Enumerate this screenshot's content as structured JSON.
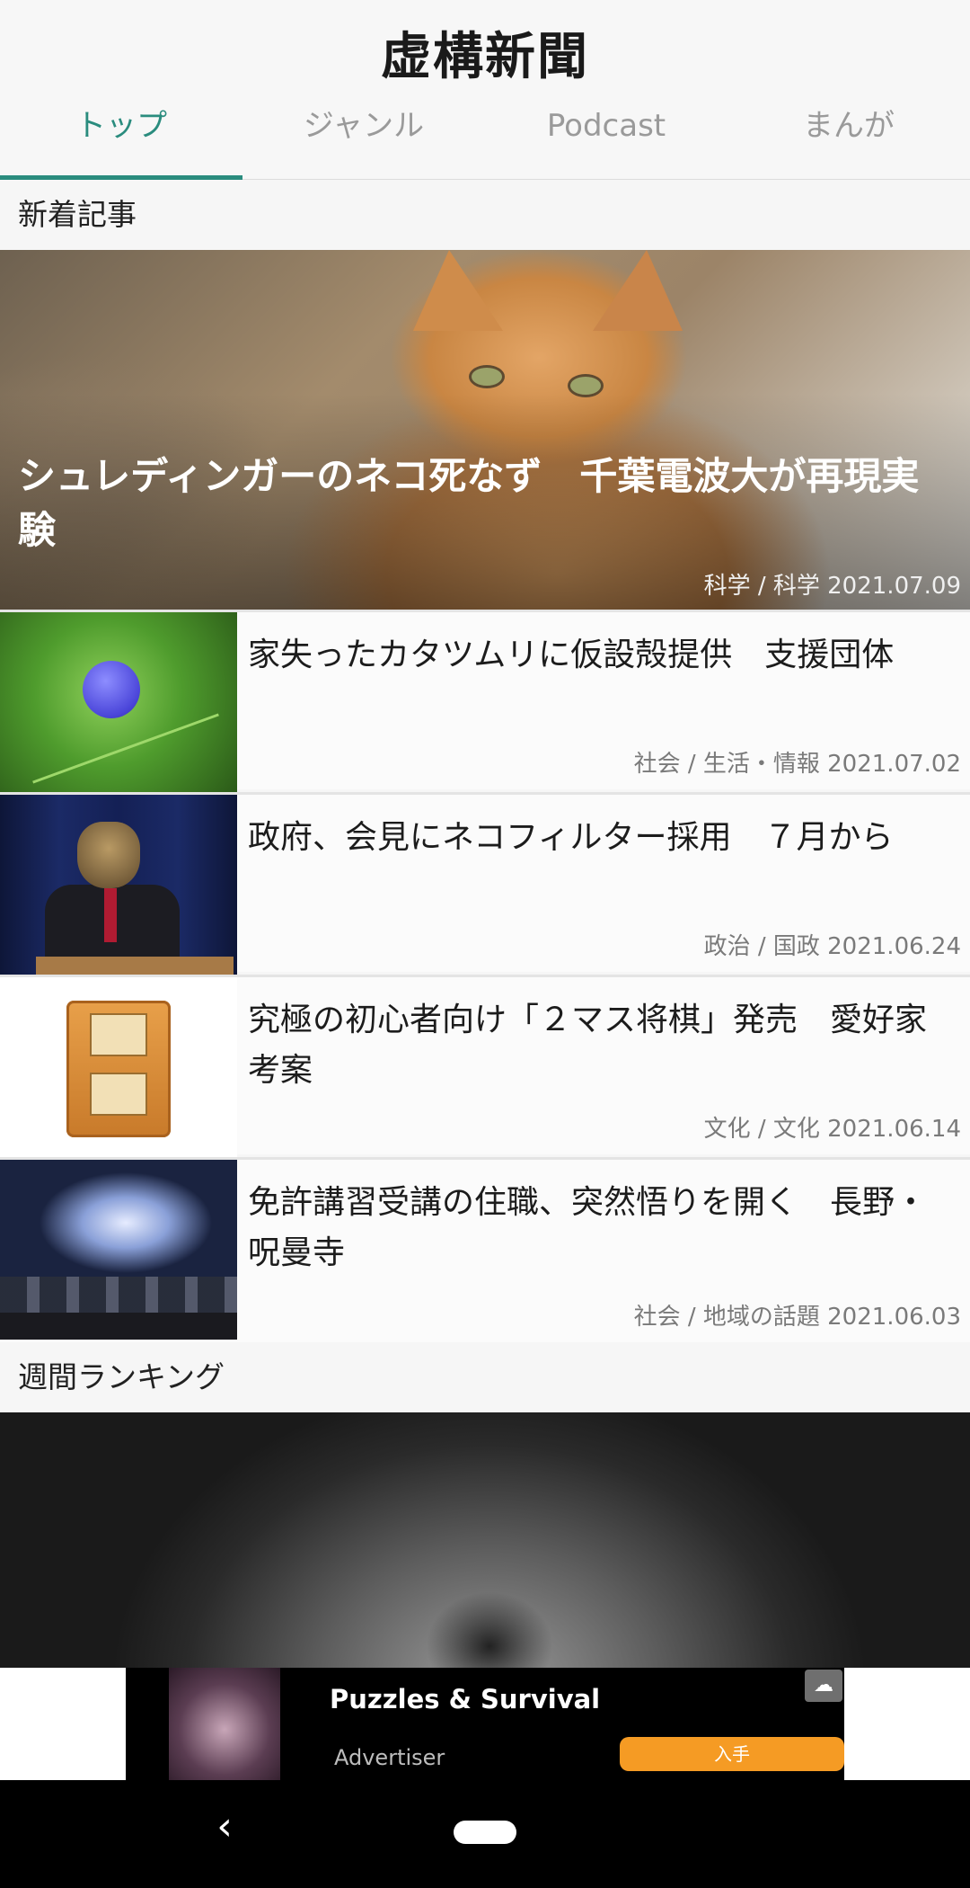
{
  "app": {
    "title": "虚構新聞"
  },
  "tabs": [
    {
      "label": "トップ",
      "active": true
    },
    {
      "label": "ジャンル",
      "active": false
    },
    {
      "label": "Podcast",
      "active": false
    },
    {
      "label": "まんが",
      "active": false
    }
  ],
  "sections": {
    "new_articles": "新着記事",
    "weekly_ranking": "週間ランキング"
  },
  "featured": {
    "title": "シュレディンガーのネコ死なず　千葉電波大が再現実験",
    "meta": "科学 / 科学 2021.07.09"
  },
  "articles": [
    {
      "title": "家失ったカタツムリに仮設殻提供　支援団体",
      "meta": "社会 / 生活・情報 2021.07.02"
    },
    {
      "title": "政府、会見にネコフィルター採用　７月から",
      "meta": "政治 / 国政 2021.06.24"
    },
    {
      "title": "究極の初心者向け「２マス将棋」発売　愛好家考案",
      "meta": "文化 / 文化 2021.06.14"
    },
    {
      "title": "免許講習受講の住職、突然悟りを開く　長野・呪曼寺",
      "meta": "社会 / 地域の話題 2021.06.03"
    }
  ],
  "ad": {
    "title": "Puzzles & Survival",
    "advertiser": "Advertiser",
    "button": "入手"
  },
  "colors": {
    "accent": "#2a8c7e",
    "ad_button": "#f59b24"
  },
  "icons": {
    "back": "back-chevron-icon",
    "home": "home-pill-icon",
    "ad_choices": "ad-choices-icon"
  }
}
